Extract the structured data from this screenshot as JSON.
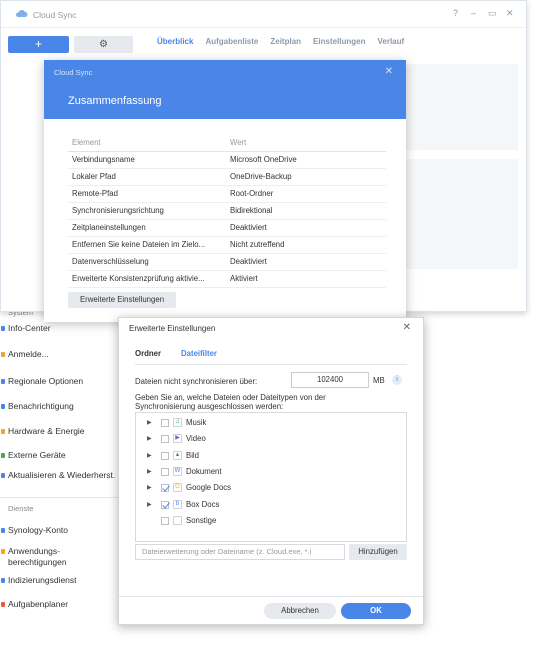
{
  "colors": {
    "accent": "#4a86e8",
    "header": "#4a86e8"
  },
  "control_panel": {
    "sections": {
      "system": "System",
      "services": "Dienste"
    },
    "system_items": [
      {
        "label": "Info-Center",
        "color": "#4a86e8"
      },
      {
        "label": "Anmelde...",
        "color": "#e8a33d"
      },
      {
        "label": "Regionale Optionen",
        "color": "#4a86e8"
      },
      {
        "label": "Benachrichtigung",
        "color": "#4a86e8"
      },
      {
        "label": "Hardware & Energie",
        "color": "#f0a81c"
      },
      {
        "label": "Externe Geräte",
        "color": "#4aa84a"
      },
      {
        "label": "Aktualisieren & Wiederherst.",
        "color": "#4a86e8"
      }
    ],
    "service_items": [
      {
        "label": "Synology-Konto",
        "color": "#4a86e8"
      },
      {
        "label": "Anwendungs-berechtigungen",
        "color": "#f0a81c"
      },
      {
        "label": "Indizierungsdienst",
        "color": "#4a86e8"
      },
      {
        "label": "Aufgabenplaner",
        "color": "#e85a3a"
      }
    ]
  },
  "cloud_sync": {
    "title": "Cloud Sync",
    "add_label": "+",
    "gear_icon": "⚙",
    "window_controls": [
      "?",
      "–",
      "▭",
      "✕"
    ],
    "tabs": [
      "Überblick",
      "Aufgabenliste",
      "Zeitplan",
      "Einstellungen",
      "Verlauf"
    ]
  },
  "summary": {
    "app_label": "Cloud Sync",
    "title": "Zusammenfassung",
    "close_glyph": "✕",
    "header": {
      "element": "Element",
      "value": "Wert"
    },
    "rows": [
      {
        "k": "Verbindungsname",
        "v": "Microsoft OneDrive"
      },
      {
        "k": "Lokaler Pfad",
        "v": "OneDrive-Backup"
      },
      {
        "k": "Remote-Pfad",
        "v": "Root-Ordner"
      },
      {
        "k": "Synchronisierungsrichtung",
        "v": "Bidirektional"
      },
      {
        "k": "Zeitplaneinstellungen",
        "v": "Deaktiviert"
      },
      {
        "k": "Entfernen Sie keine Dateien im Zielo...",
        "v": "Nicht zutreffend"
      },
      {
        "k": "Datenverschlüsselung",
        "v": "Deaktiviert"
      },
      {
        "k": "Erweiterte Konsistenzprüfung aktivie...",
        "v": "Aktiviert"
      }
    ],
    "advanced_button": "Erweiterte Einstellungen"
  },
  "advanced": {
    "title": "Erweiterte Einstellungen",
    "close_glyph": "✕",
    "tabs": {
      "folder": "Ordner",
      "file_filter": "Dateifilter"
    },
    "size_label": "Dateien nicht synchronisieren über:",
    "size_value": "102400",
    "size_unit": "MB",
    "info_glyph": "i",
    "types_label_1": "Geben Sie an, welche Dateien oder Dateitypen von der",
    "types_label_2": "Synchronisierung ausgeschlossen werden:",
    "file_types": [
      {
        "name": "Musik",
        "checked": false,
        "expand": true,
        "icon": "♫",
        "color": "#3aa64a"
      },
      {
        "name": "Video",
        "checked": false,
        "expand": true,
        "icon": "▶",
        "color": "#7b5bd6"
      },
      {
        "name": "Bild",
        "checked": false,
        "expand": true,
        "icon": "▲",
        "color": "#3aa64a"
      },
      {
        "name": "Dokument",
        "checked": false,
        "expand": true,
        "icon": "W",
        "color": "#4a86e8"
      },
      {
        "name": "Google Docs",
        "checked": true,
        "expand": true,
        "icon": "G",
        "color": "#f0a81c"
      },
      {
        "name": "Box Docs",
        "checked": true,
        "expand": true,
        "icon": "b",
        "color": "#4a86e8"
      },
      {
        "name": "Sonstige",
        "checked": false,
        "expand": false,
        "icon": "",
        "color": "#999999"
      }
    ],
    "search_placeholder": "Dateierweiterung oder Dateiname (z. Cloud.exe, *.i",
    "add_button": "Hinzufügen",
    "cancel_button": "Abbrechen",
    "ok_button": "OK"
  }
}
